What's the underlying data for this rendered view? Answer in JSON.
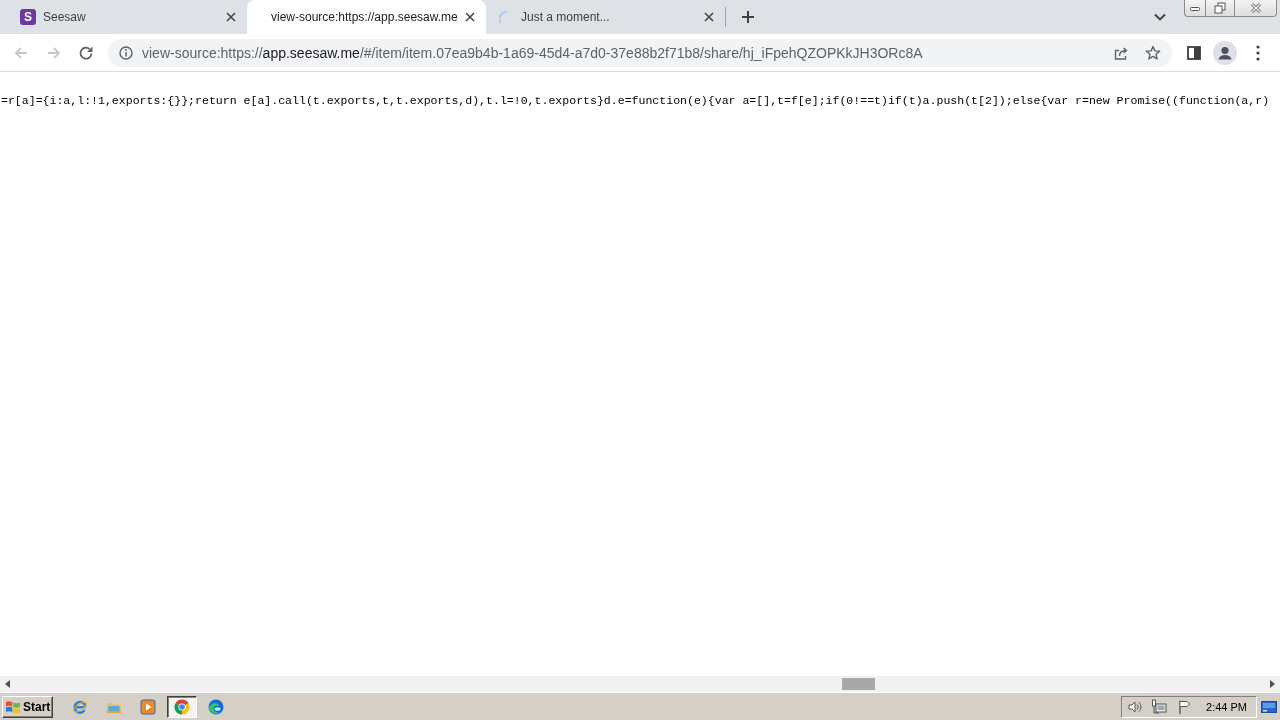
{
  "tabs": [
    {
      "kind": "site",
      "favicon_letter": "S",
      "title": "Seesaw",
      "selected": false
    },
    {
      "kind": "plain",
      "title": "view-source:https://app.seesaw.me",
      "selected": true
    },
    {
      "kind": "loading",
      "title": "Just a moment...",
      "selected": false
    }
  ],
  "toolbar": {
    "back": {
      "disabled": true
    },
    "forward": {
      "disabled": true
    },
    "url": {
      "scheme": "view-source:https://",
      "host": "app.seesaw.me",
      "path": "/#/item/item.07ea9b4b-1a69-45d4-a7d0-37e88b2f71b8/share/hj_iFpehQZOPKkJH3ORc8A"
    }
  },
  "source_lines": [
    "=r[a]={i:a,l:!1,exports:{}};return e[a].call(t.exports,t,t.exports,d),t.l=!0,t.exports}d.e=function(e){var a=[],t=f[e];if(0!==t)if(t)a.push(t[2]);else{var r=new Promise((function(a,r)"
  ],
  "taskbar": {
    "start_label": "Start",
    "apps": [
      {
        "kind": "e-browser",
        "selected": false
      },
      {
        "kind": "folder",
        "selected": false
      },
      {
        "kind": "media",
        "selected": false
      },
      {
        "kind": "ring-browser",
        "selected": true
      },
      {
        "kind": "wave-browser",
        "selected": false
      }
    ],
    "clock": "2:44 PM"
  }
}
